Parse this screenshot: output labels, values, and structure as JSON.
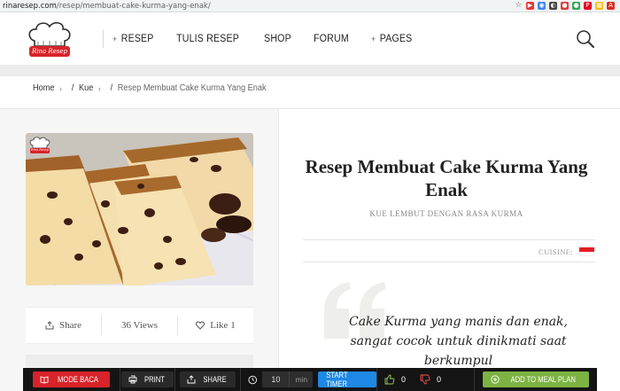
{
  "browser": {
    "url_host": "rinaresep.com",
    "url_path": "/resep/membuat-cake-kurma-yang-enak/",
    "extensions": [
      {
        "name": "youtube-icon",
        "color": "#e53935",
        "glyph": "▶"
      },
      {
        "name": "chrome-ext-icon",
        "color": "#4285f4",
        "glyph": "◉"
      },
      {
        "name": "dark-ext-icon",
        "color": "#424242",
        "glyph": "◐"
      },
      {
        "name": "red-circle-icon",
        "color": "#e53935",
        "glyph": "●"
      },
      {
        "name": "green-ext-icon",
        "color": "#34a853",
        "glyph": "●"
      },
      {
        "name": "pinterest-icon",
        "color": "#e60023",
        "glyph": "P"
      },
      {
        "name": "grid-ext-icon",
        "color": "#fbbc05",
        "glyph": "▦"
      },
      {
        "name": "pdf-icon",
        "color": "#d93025",
        "glyph": "A"
      }
    ]
  },
  "logo": {
    "text": "Rina Resep"
  },
  "nav": [
    {
      "label": "RESEP",
      "plus": true
    },
    {
      "label": "TULIS RESEP",
      "plus": false
    },
    {
      "label": "SHOP",
      "plus": false
    },
    {
      "label": "FORUM",
      "plus": false
    },
    {
      "label": "PAGES",
      "plus": true
    }
  ],
  "breadcrumb": {
    "home": "Home",
    "kue": "Kue",
    "current": "Resep Membuat Cake Kurma Yang Enak"
  },
  "photo": {
    "badge": "Rina Resep"
  },
  "stats": {
    "share": "Share",
    "views": "36 Views",
    "like": "Like 1"
  },
  "article": {
    "title": "Resep Membuat Cake Kurma Yang Enak",
    "subtitle": "KUE LEMBUT DENGAN RASA KURMA",
    "cuisine_label": "CUISINE:",
    "quote": "Cake Kurma yang manis dan enak, sangat cocok untuk dinikmati saat berkumpul"
  },
  "toolbar": {
    "mode_baca": "MODE BACA",
    "print": "PRINT",
    "share": "SHARE",
    "timer_value": "10",
    "timer_unit": "min",
    "start_timer": "START TIMER",
    "likes": "0",
    "dislikes": "0",
    "add_meal_plan": "ADD TO MEAL PLAN"
  },
  "colors": {
    "accent_red": "#d8232a",
    "timer_blue": "#1e88e5",
    "meal_green": "#7cb342"
  }
}
